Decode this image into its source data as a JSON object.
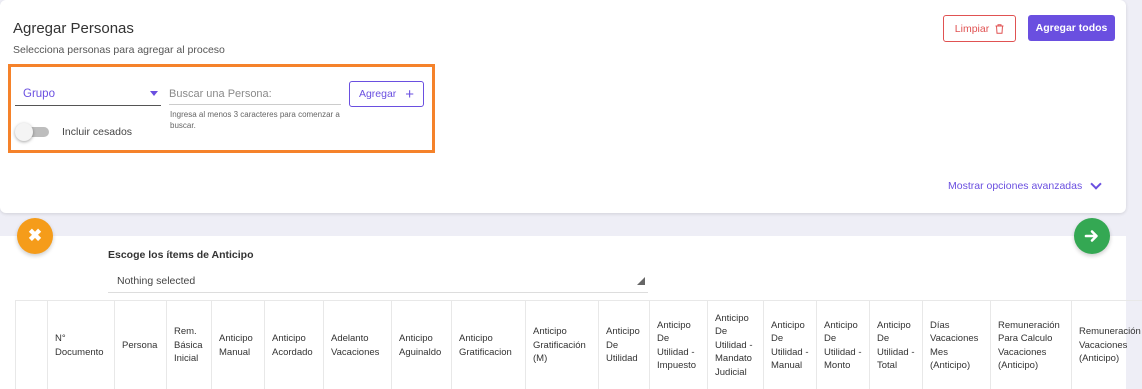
{
  "header": {
    "title": "Agregar Personas",
    "subtitle": "Selecciona personas para agregar al proceso",
    "clear_label": "Limpiar",
    "add_all_label": "Agregar todos"
  },
  "filters": {
    "group_label": "Grupo",
    "search_placeholder": "Buscar una Persona:",
    "search_hint": "Ingresa al menos 3 caracteres para comenzar a buscar.",
    "add_label": "Agregar",
    "include_ceased_label": "Incluir cesados",
    "include_ceased_on": false
  },
  "advanced_link": "Mostrar opciones avanzadas",
  "items": {
    "label": "Escoge los ítems de Anticipo",
    "selected": "Nothing selected"
  },
  "table": {
    "columns": [
      "",
      "N° Documento",
      "Persona",
      "Rem. Básica Inicial",
      "Anticipo Manual",
      "Anticipo Acordado",
      "Adelanto Vacaciones",
      "Anticipo Aguinaldo",
      "Anticipo Gratificacion",
      "Anticipo Gratificación (M)",
      "Anticipo De Utilidad",
      "Anticipo De Utilidad - Impuesto",
      "Anticipo De Utilidad - Mandato Judicial",
      "Anticipo De Utilidad - Manual",
      "Anticipo De Utilidad - Monto",
      "Anticipo De Utilidad - Total",
      "Días Vacaciones Mes (Anticipo)",
      "Remuneración Para Calculo Vacaciones (Anticipo)",
      "Remuneración Vacaciones (Anticipo)"
    ]
  },
  "colors": {
    "primary": "#6a4fe0",
    "danger": "#e05252",
    "highlight": "#f5822a",
    "cancel": "#f59c1a",
    "next": "#34a853"
  }
}
